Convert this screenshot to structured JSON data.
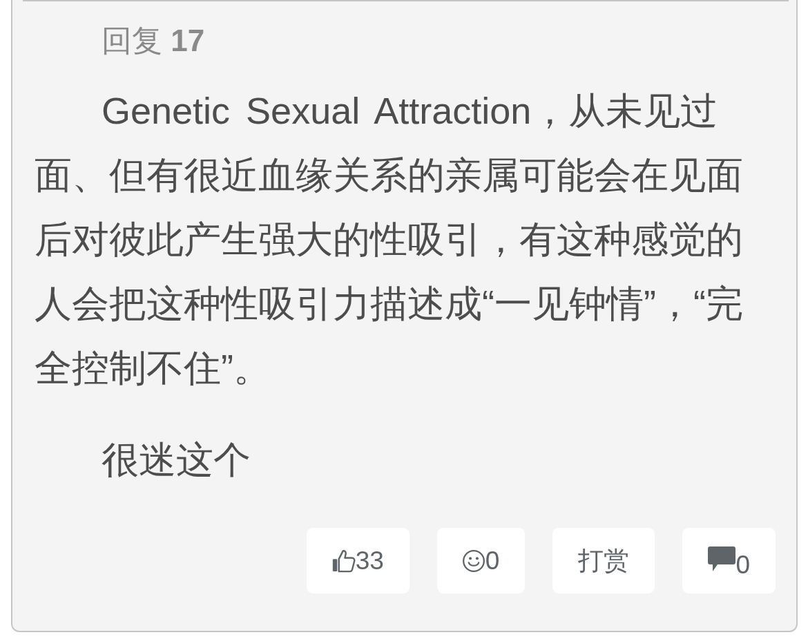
{
  "reply": {
    "label": "回复 **17**"
  },
  "paragraphs": [
    "Genetic Sexual Attraction，从未见过面、但有很近血缘关系的亲属可能会在见面后对彼此产生强大的性吸引，有这种感觉的人会把这种性吸引力描述成“一见钟情”，“完全控制不住”。",
    "很迷这个"
  ],
  "actions": [
    {
      "kind": "like",
      "count": "33"
    },
    {
      "kind": "emoji",
      "count": "0"
    },
    {
      "kind": "tip",
      "label": "打赏"
    },
    {
      "kind": "comment",
      "count": "0"
    }
  ]
}
